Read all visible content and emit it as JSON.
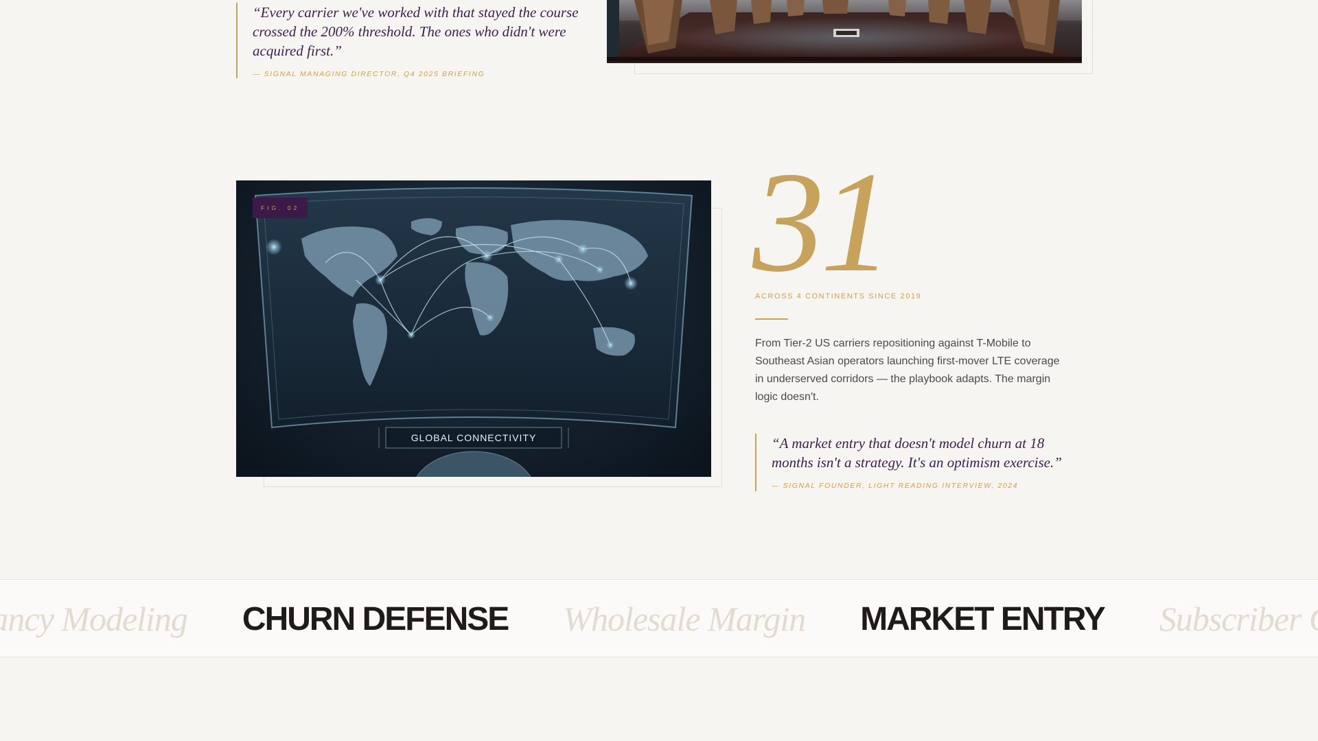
{
  "top_quote": {
    "text": "“Every carrier we've worked with that stayed the course crossed the 200% threshold. The ones who didn't were acquired first.”",
    "attribution": "— SIGNAL MANAGING DIRECTOR, Q4 2025 BRIEFING"
  },
  "figure": {
    "label": "FIG. 02",
    "overlay_text": "GLOBAL CONNECTIVITY"
  },
  "stat": {
    "number": "31",
    "caption": "ACROSS 4 CONTINENTS SINCE 2019",
    "body": "From Tier-2 US carriers repositioning against T-Mobile to Southeast Asian operators launching first-mover LTE coverage in underserved corridors — the playbook adapts. The margin logic doesn't."
  },
  "side_quote": {
    "text": "“A market entry that doesn't model churn at 18 months isn't a strategy. It's an optimism exercise.”",
    "attribution": "— SIGNAL FOUNDER, LIGHT READING INTERVIEW, 2024"
  },
  "marquee": {
    "items": [
      {
        "text": "Tenancy Modeling",
        "style": "italic"
      },
      {
        "text": "CHURN DEFENSE",
        "style": "bold"
      },
      {
        "text": "Wholesale Margin",
        "style": "italic"
      },
      {
        "text": "MARKET ENTRY",
        "style": "bold"
      },
      {
        "text": "Subscriber Growth",
        "style": "italic"
      }
    ]
  },
  "colors": {
    "background": "#f7f5f2",
    "gold": "#c6a25a",
    "plum": "#3b1f4a",
    "ink": "#1f1b18"
  }
}
